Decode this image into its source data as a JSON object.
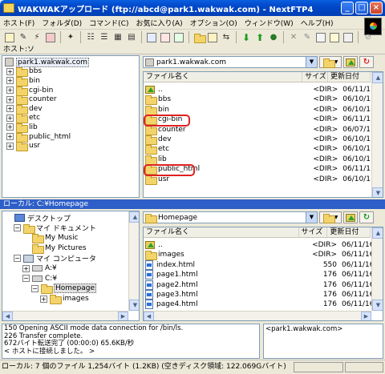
{
  "window": {
    "title": "WAKWAKアップロード (ftp://abcd@park1.wakwak.com) - NextFTP4",
    "btn_min": "_",
    "btn_max": "□",
    "btn_close": "×"
  },
  "menu": [
    "ホスト(F)",
    "フォルダ(D)",
    "コマンド(C)",
    "お気に入り(A)",
    "オプション(O)",
    "ウィンドウ(W)",
    "ヘルプ(H)"
  ],
  "hostbar": "ホスト:ソ",
  "remote": {
    "tree_root": "park1.wakwak.com",
    "tree_items": [
      "bbs",
      "bin",
      "cgi-bin",
      "counter",
      "dev",
      "etc",
      "lib",
      "public_html",
      "usr"
    ],
    "address": "park1.wakwak.com",
    "col_name": "ファイル名く",
    "col_size": "サイズ",
    "col_date": "更新日付",
    "rows": [
      {
        "name": "..",
        "size": "<DIR>",
        "date": "06/11/1"
      },
      {
        "name": "bbs",
        "size": "<DIR>",
        "date": "06/10/1"
      },
      {
        "name": "bin",
        "size": "<DIR>",
        "date": "06/10/1"
      },
      {
        "name": "cgi-bin",
        "size": "<DIR>",
        "date": "06/11/1"
      },
      {
        "name": "counter",
        "size": "<DIR>",
        "date": "06/07/1"
      },
      {
        "name": "dev",
        "size": "<DIR>",
        "date": "06/10/1"
      },
      {
        "name": "etc",
        "size": "<DIR>",
        "date": "06/10/1"
      },
      {
        "name": "lib",
        "size": "<DIR>",
        "date": "06/10/1"
      },
      {
        "name": "public_html",
        "size": "<DIR>",
        "date": "06/11/1"
      },
      {
        "name": "usr",
        "size": "<DIR>",
        "date": "06/10/1"
      }
    ]
  },
  "localbar": "ローカル: C:¥Homepage",
  "local": {
    "tree": [
      {
        "label": "デスクトップ",
        "indent": 0,
        "expander": ""
      },
      {
        "label": "マイ ドキュメント",
        "indent": 1,
        "expander": "−"
      },
      {
        "label": "My Music",
        "indent": 2,
        "expander": ""
      },
      {
        "label": "My Pictures",
        "indent": 2,
        "expander": ""
      },
      {
        "label": "マイ コンピュータ",
        "indent": 1,
        "expander": "−"
      },
      {
        "label": "A:¥",
        "indent": 2,
        "expander": "+"
      },
      {
        "label": "C:¥",
        "indent": 2,
        "expander": "−"
      },
      {
        "label": "Homepage",
        "indent": 3,
        "expander": "−"
      },
      {
        "label": "images",
        "indent": 4,
        "expander": "+"
      }
    ],
    "address": "Homepage",
    "col_name": "ファイル名く",
    "col_size": "サイズ",
    "col_date": "更新日付",
    "rows": [
      {
        "name": "..",
        "size": "<DIR>",
        "date": "06/11/16 1",
        "type": "up"
      },
      {
        "name": "images",
        "size": "<DIR>",
        "date": "06/11/16 1",
        "type": "folder"
      },
      {
        "name": "index.html",
        "size": "550",
        "date": "06/11/16 1",
        "type": "file"
      },
      {
        "name": "page1.html",
        "size": "176",
        "date": "06/11/16 1",
        "type": "file"
      },
      {
        "name": "page2.html",
        "size": "176",
        "date": "06/11/16 1",
        "type": "file"
      },
      {
        "name": "page3.html",
        "size": "176",
        "date": "06/11/16 1",
        "type": "file"
      },
      {
        "name": "page4.html",
        "size": "176",
        "date": "06/11/16 1",
        "type": "file"
      }
    ]
  },
  "log": [
    "150 Opening ASCII mode data connection for /bin/ls.",
    "226 Transfer complete.",
    "672バイト転送完了 (00:00:0) 65.6KB/秒",
    "< ホストに接続しました。 >"
  ],
  "queue": "<park1.wakwak.com>",
  "status": "ローカル: 7 個のファイル  1,254バイト (1.2KB)  (空きディスク領域: 122.069Gバイト)",
  "highlight_color": "#e02020"
}
